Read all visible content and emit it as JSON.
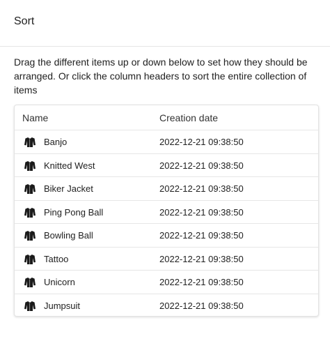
{
  "dialog": {
    "title": "Sort",
    "instructions": "Drag the different items up or down below to set how they should be arranged. Or click the column headers to sort the entire collection of items"
  },
  "table": {
    "columns": [
      "Name",
      "Creation date"
    ],
    "row_icon": "sweater-icon",
    "rows": [
      {
        "name": "Banjo",
        "date": "2022-12-21 09:38:50"
      },
      {
        "name": "Knitted West",
        "date": "2022-12-21 09:38:50"
      },
      {
        "name": "Biker Jacket",
        "date": "2022-12-21 09:38:50"
      },
      {
        "name": "Ping Pong Ball",
        "date": "2022-12-21 09:38:50"
      },
      {
        "name": "Bowling Ball",
        "date": "2022-12-21 09:38:50"
      },
      {
        "name": "Tattoo",
        "date": "2022-12-21 09:38:50"
      },
      {
        "name": "Unicorn",
        "date": "2022-12-21 09:38:50"
      },
      {
        "name": "Jumpsuit",
        "date": "2022-12-21 09:38:50"
      }
    ]
  }
}
